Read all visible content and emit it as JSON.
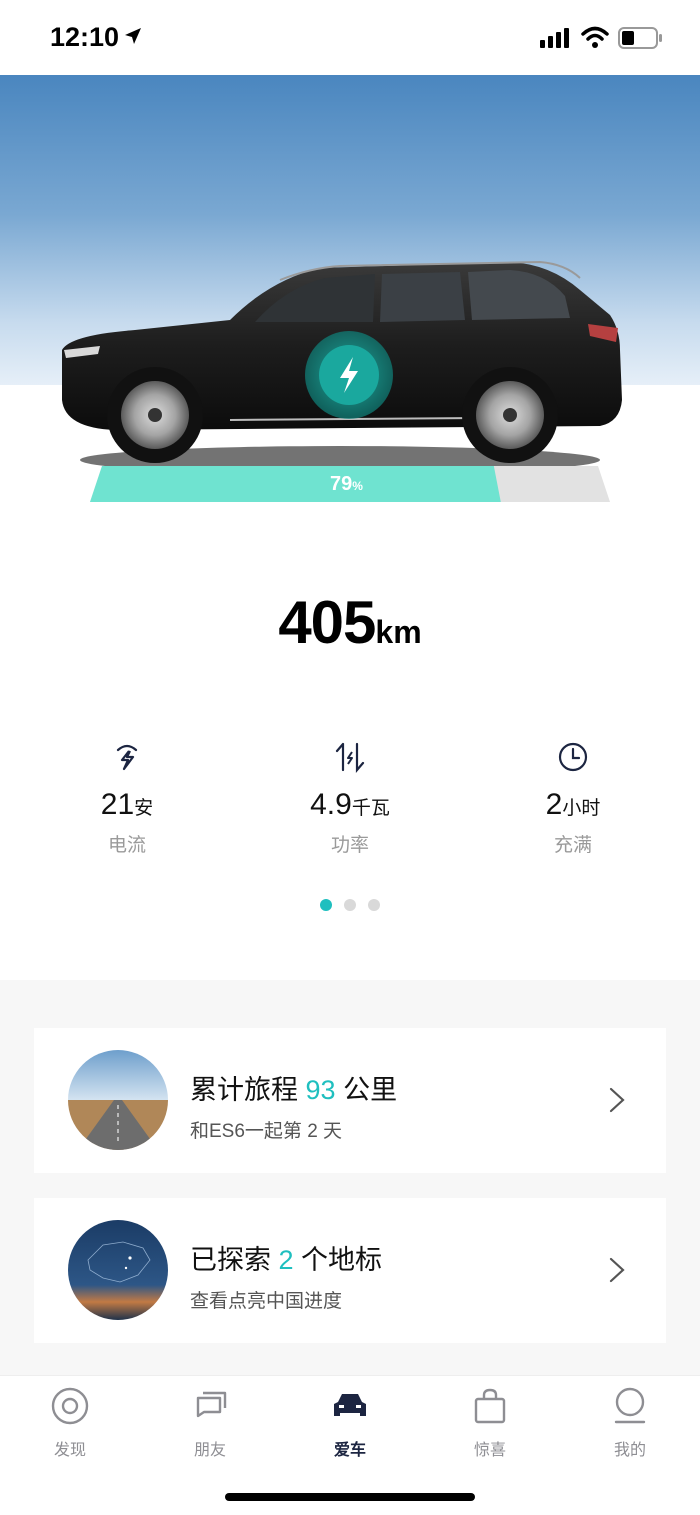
{
  "status_bar": {
    "time": "12:10"
  },
  "vehicle": {
    "charge_percent": 79,
    "charge_unit": "%",
    "range_value": "405",
    "range_unit": "km"
  },
  "stats": [
    {
      "icon": "current-icon",
      "value": "21",
      "unit": "安",
      "label": "电流"
    },
    {
      "icon": "power-icon",
      "value": "4.9",
      "unit": "千瓦",
      "label": "功率"
    },
    {
      "icon": "clock-icon",
      "value": "2",
      "unit": "小时",
      "label": "充满"
    }
  ],
  "pager": {
    "count": 3,
    "active": 0
  },
  "cards": [
    {
      "title_prefix": "累计旅程 ",
      "highlight": "93",
      "title_suffix": " 公里",
      "subtitle": "和ES6一起第 2 天"
    },
    {
      "title_prefix": "已探索 ",
      "highlight": "2",
      "title_suffix": " 个地标",
      "subtitle": "查看点亮中国进度"
    }
  ],
  "tabs": [
    {
      "label": "发现",
      "icon": "discover-icon"
    },
    {
      "label": "朋友",
      "icon": "chat-icon"
    },
    {
      "label": "爱车",
      "icon": "car-icon",
      "active": true
    },
    {
      "label": "惊喜",
      "icon": "shopping-bag-icon"
    },
    {
      "label": "我的",
      "icon": "profile-icon"
    }
  ],
  "colors": {
    "accent": "#1fbfbf",
    "charge_fill": "#6fe3d0",
    "tab_active": "#1c2541"
  }
}
